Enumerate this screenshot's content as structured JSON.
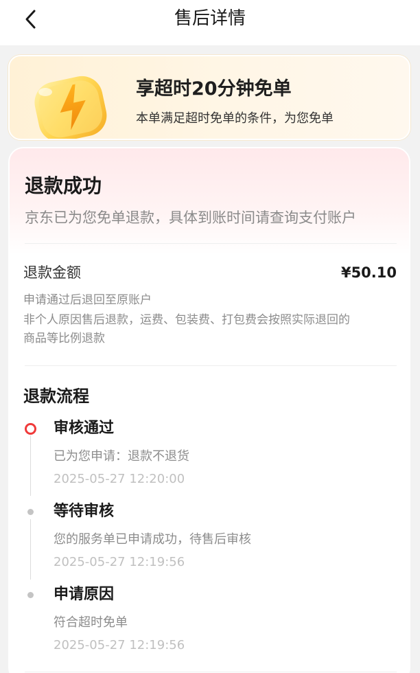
{
  "header": {
    "title": "售后详情",
    "back_icon": "chevron-left-icon"
  },
  "promo": {
    "title": "享超时20分钟免单",
    "subtitle": "本单满足超时免单的条件，为您免单",
    "icon": "lightning-badge-icon"
  },
  "refund": {
    "status_title": "退款成功",
    "status_desc": "京东已为您免单退款，具体到账时间请查询支付账户",
    "amount_label": "退款金额",
    "amount_value": "¥50.10",
    "note_1": "申请通过后退回至原账户",
    "note_2_line1": "非个人原因售后退款，运费、包装费、打包费会按照实际退回的",
    "note_2_line2": "商品等比例退款"
  },
  "flow": {
    "title": "退款流程",
    "steps": [
      {
        "title": "审核通过",
        "desc": "已为您申请：退款不退货",
        "time": "2025-05-27 12:20:00",
        "active": true
      },
      {
        "title": "等待审核",
        "desc": "您的服务单已申请成功，待售后审核",
        "time": "2025-05-27 12:19:56",
        "active": false
      },
      {
        "title": "申请原因",
        "desc": "符合超时免单",
        "time": "2025-05-27 12:19:56",
        "active": false
      }
    ]
  },
  "colors": {
    "accent_red": "#f03a3a",
    "promo_bg": "#fff1d6",
    "page_bg": "#f2f2f2"
  }
}
